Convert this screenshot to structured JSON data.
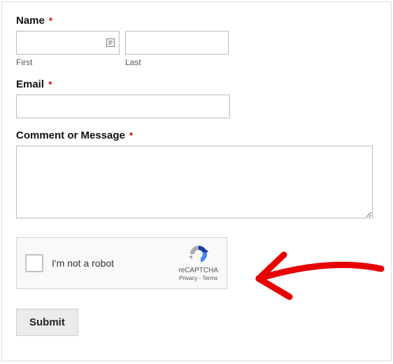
{
  "form": {
    "name": {
      "label": "Name",
      "required_mark": "*",
      "first_sublabel": "First",
      "last_sublabel": "Last",
      "first_value": "",
      "last_value": ""
    },
    "email": {
      "label": "Email",
      "required_mark": "*",
      "value": ""
    },
    "comment": {
      "label": "Comment or Message",
      "required_mark": "*",
      "value": ""
    },
    "recaptcha": {
      "text": "I'm not a robot",
      "brand": "reCAPTCHA",
      "privacy": "Privacy",
      "separator": " - ",
      "terms": "Terms"
    },
    "submit_label": "Submit"
  },
  "annotation": {
    "arrow_color": "#e60000"
  }
}
